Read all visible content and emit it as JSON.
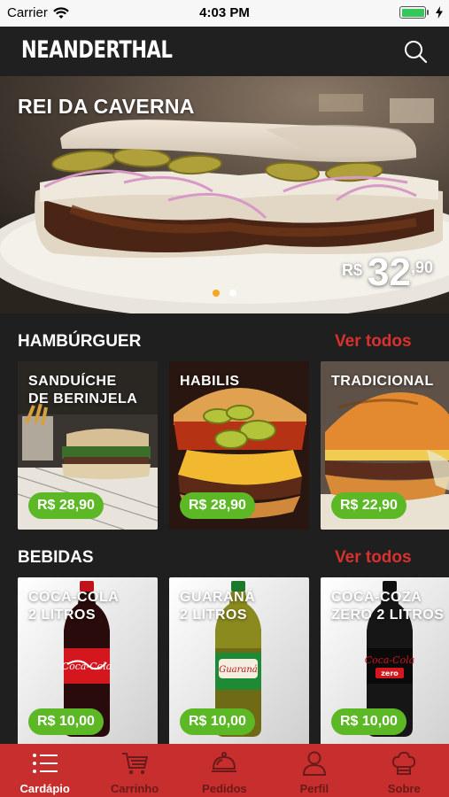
{
  "status_bar": {
    "carrier": "Carrier",
    "time": "4:03 PM",
    "battery_level": 1.0
  },
  "header": {
    "brand": "NEANDERTHAL",
    "search_icon": "search-icon"
  },
  "hero": {
    "title": "REI DA CAVERNA",
    "price_currency": "R$",
    "price_integer": "32",
    "price_decimal": ",90",
    "slides": 2,
    "active_slide": 1
  },
  "sections": [
    {
      "title": "HAMBÚRGUER",
      "see_all": "Ver todos",
      "items": [
        {
          "name": "SANDUÍCHE\nDE BERINJELA",
          "price": "R$ 28,90"
        },
        {
          "name": "HABILIS",
          "price": "R$ 28,90"
        },
        {
          "name": "TRADICIONAL",
          "price": "R$ 22,90"
        }
      ]
    },
    {
      "title": "BEBIDAS",
      "see_all": "Ver todos",
      "items": [
        {
          "name": "COCA-COLA\n2 LITROS",
          "price": "R$ 10,00"
        },
        {
          "name": "GUARANÁ\n2 LITROS",
          "price": "R$ 10,00"
        },
        {
          "name": "COCA-COZA\nZERO 2 LITROS",
          "price": "R$ 10,00"
        }
      ]
    }
  ],
  "tab_bar": {
    "items": [
      {
        "label": "Cardápio",
        "icon": "menu-list-icon",
        "active": true
      },
      {
        "label": "Carrinho",
        "icon": "cart-icon",
        "active": false
      },
      {
        "label": "Pedidos",
        "icon": "cloche-icon",
        "active": false
      },
      {
        "label": "Perfil",
        "icon": "user-icon",
        "active": false
      },
      {
        "label": "Sobre",
        "icon": "chef-hat-icon",
        "active": false
      }
    ]
  },
  "colors": {
    "accent_red": "#c62f2d",
    "link_red": "#d9312e",
    "price_green": "#5cb824",
    "active_dot": "#f5a623"
  }
}
